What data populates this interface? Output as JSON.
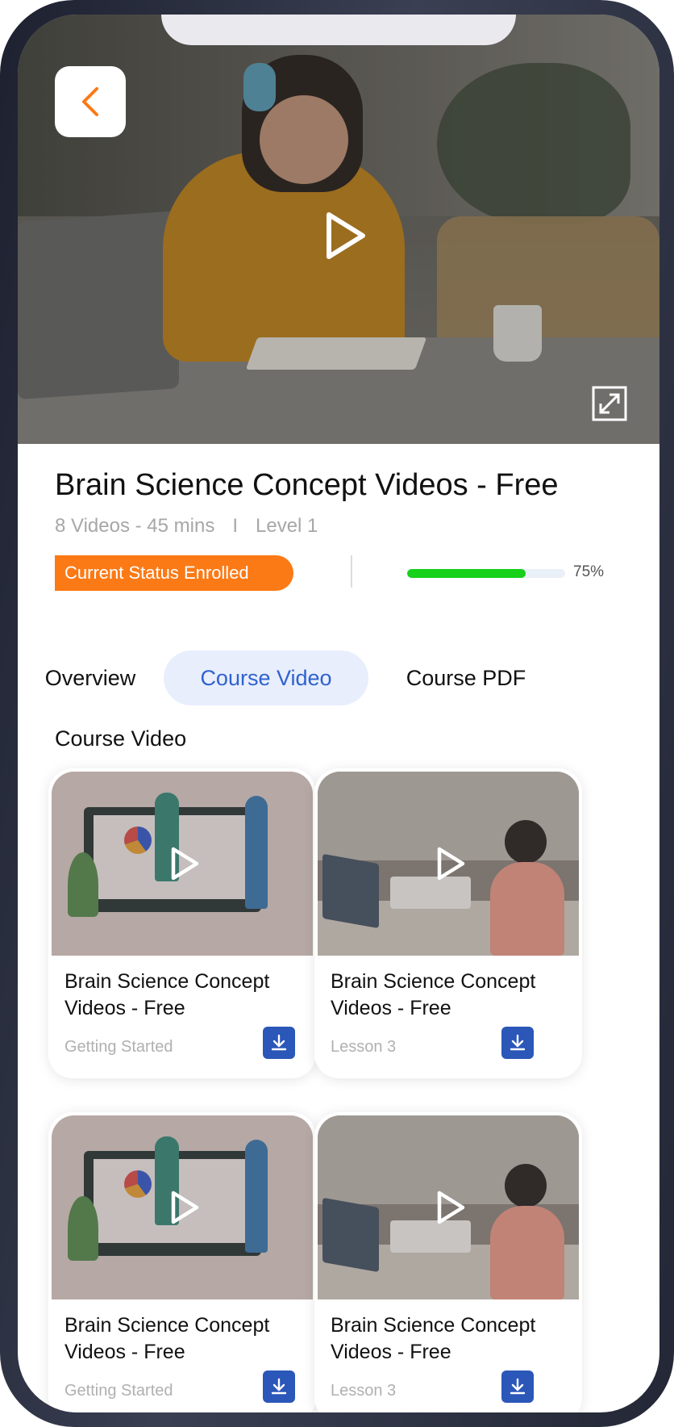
{
  "course": {
    "title": "Brain Science Concept Videos - Free",
    "videos_info": "8 Videos - 45 mins",
    "separator": "I",
    "level": "Level 1",
    "status": "Current Status Enrolled",
    "progress_percent": 75,
    "progress_label": "75%"
  },
  "tabs": [
    {
      "label": "Overview",
      "active": false
    },
    {
      "label": "Course Video",
      "active": true
    },
    {
      "label": "Course PDF",
      "active": false
    }
  ],
  "section_title": "Course Video",
  "videos": [
    {
      "title": "Brain Science Concept Videos - Free",
      "subtitle": "Getting Started",
      "thumbnail": "illustration"
    },
    {
      "title": "Brain Science Concept Videos - Free",
      "subtitle": "Lesson 3",
      "thumbnail": "photo"
    },
    {
      "title": "Brain Science Concept Videos - Free",
      "subtitle": "Getting Started",
      "thumbnail": "illustration"
    },
    {
      "title": "Brain Science Concept Videos - Free",
      "subtitle": "Lesson 3",
      "thumbnail": "photo"
    }
  ],
  "colors": {
    "accent_orange": "#fb7a16",
    "accent_blue": "#2f62cf",
    "progress_green": "#17d11b",
    "download_blue": "#2a57b8"
  },
  "icons": [
    "back-chevron-icon",
    "play-icon",
    "expand-icon",
    "download-icon"
  ]
}
